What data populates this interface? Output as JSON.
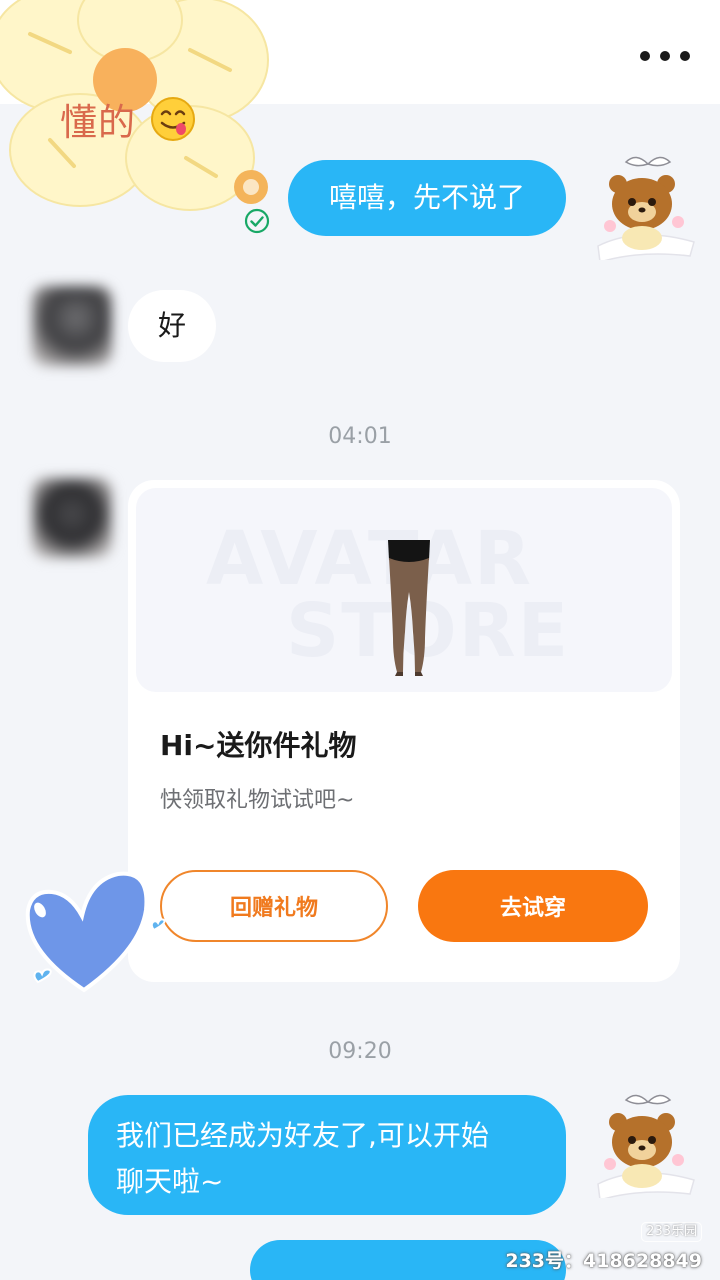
{
  "header": {
    "more_icon": "more-horizontal-icon"
  },
  "sticker": {
    "text": "懂的",
    "emoji": "yum-face-emoji"
  },
  "messages": {
    "m1": {
      "text": "嘻嘻，先不说了",
      "status_icon": "read-check-icon"
    },
    "m2": {
      "text": "好"
    },
    "m3": {
      "text_line1": "我们已经成为好友了,可以开始",
      "text_line2": "聊天啦~"
    }
  },
  "timestamps": {
    "t1": "04:01",
    "t2": "09:20"
  },
  "gift_card": {
    "watermark_line1": "AVATAR",
    "watermark_line2": "STORE",
    "item_icon": "tights-icon",
    "title": "Hi~送你件礼物",
    "subtitle": "快领取礼物试试吧~",
    "return_gift_label": "回赠礼物",
    "try_on_label": "去试穿"
  },
  "watermark": {
    "badge": "233乐园",
    "id": "233号：418628849"
  },
  "colors": {
    "outgoing_bubble": "#29b6f6",
    "incoming_bubble": "#ffffff",
    "accent_orange": "#f97710",
    "background": "#f3f5f9"
  }
}
